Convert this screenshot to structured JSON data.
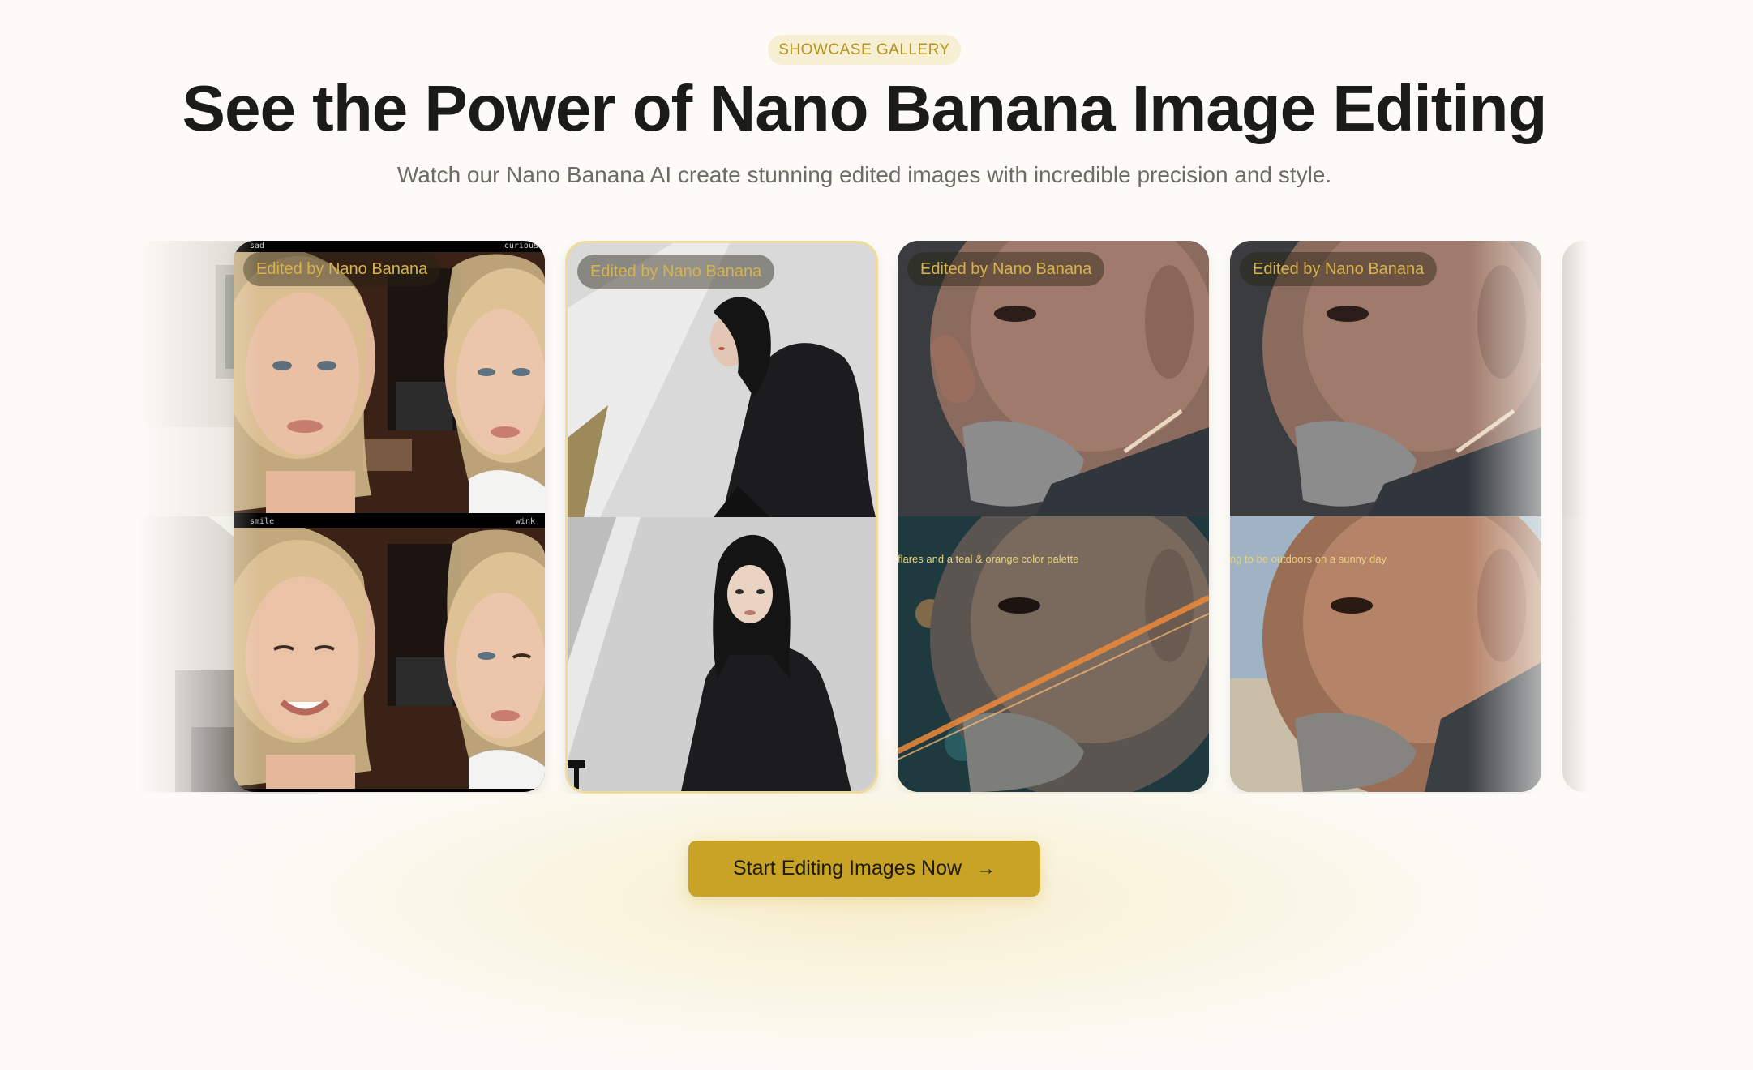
{
  "section": {
    "badge": "SHOWCASE GALLERY",
    "title": "See the Power of Nano Banana Image Editing",
    "subtitle": "Watch our Nano Banana AI create stunning edited images with incredible precision and style."
  },
  "gallery": {
    "card_label": "Edited by Nano Banana",
    "cards": [
      {
        "id": "portrait-expressions",
        "labels": [
          "sad",
          "curious",
          "smile",
          "wink"
        ]
      },
      {
        "id": "woman-black-suit"
      },
      {
        "id": "man-closeup-teal-orange",
        "caption": "flares and a teal & orange color palette"
      },
      {
        "id": "man-closeup-daylight",
        "caption": "ng to be outdoors on a sunny day"
      }
    ]
  },
  "cta": {
    "label": "Start Editing Images Now",
    "icon": "arrow-right-icon"
  },
  "colors": {
    "accent": "#c9a325",
    "badge_bg": "#f6efd4",
    "badge_text": "#b8941c",
    "background": "#fcfbf7",
    "title": "#1b1b19"
  }
}
